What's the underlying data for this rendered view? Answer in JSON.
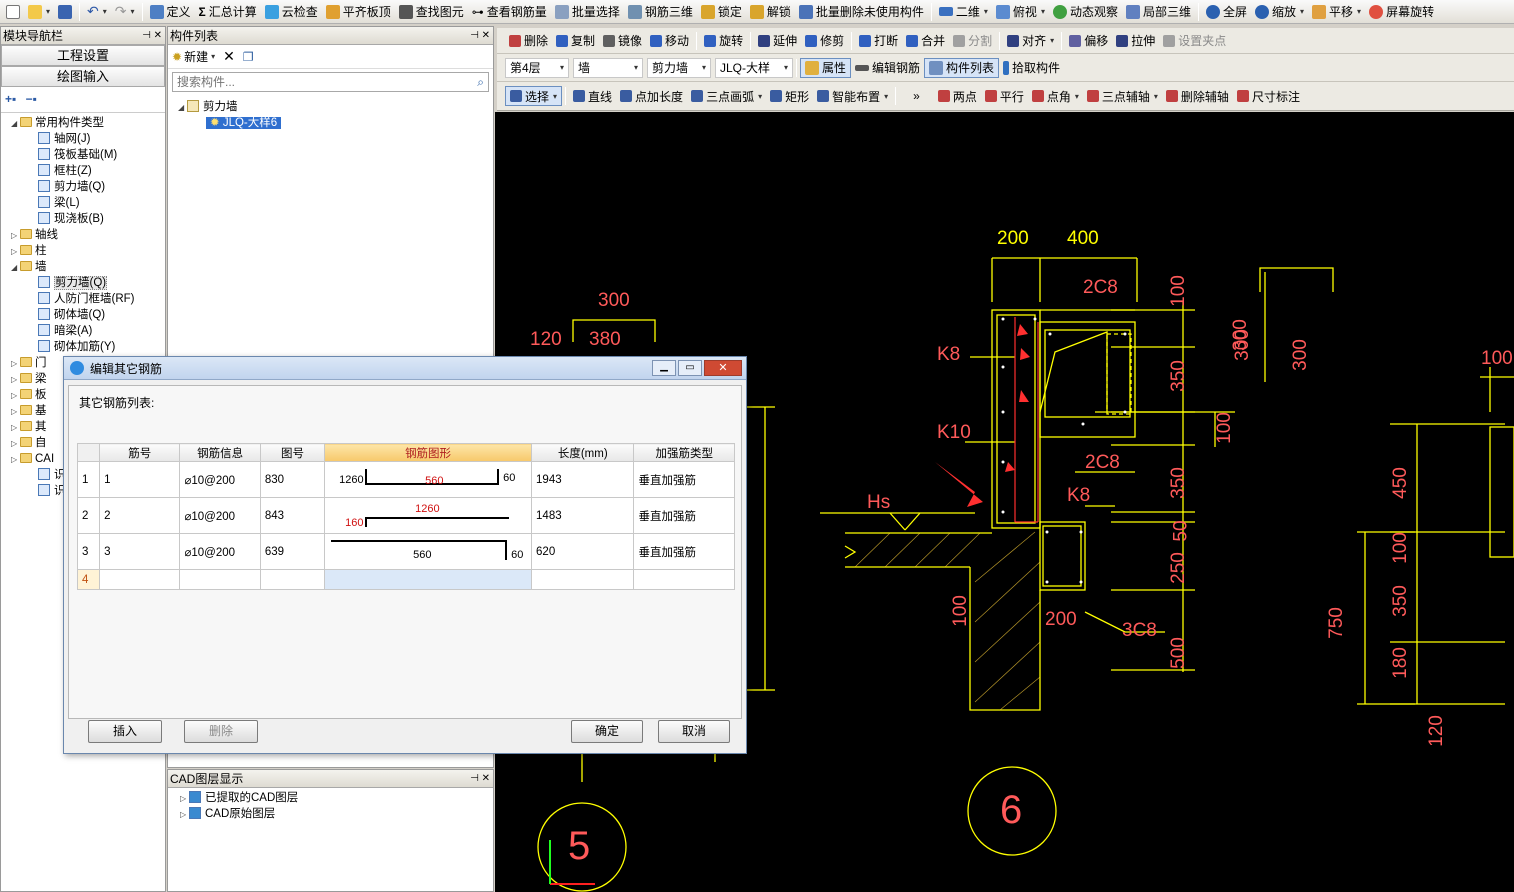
{
  "toolbar1": [
    "定义",
    "汇总计算",
    "云检查",
    "平齐板顶",
    "查找图元",
    "查看钢筋量",
    "批量选择",
    "钢筋三维",
    "锁定",
    "解锁",
    "批量删除未使用构件",
    "二维",
    "俯视",
    "动态观察",
    "局部三维",
    "全屏",
    "缩放",
    "平移",
    "屏幕旋转"
  ],
  "toolbar2": [
    "删除",
    "复制",
    "镜像",
    "移动",
    "旋转",
    "延伸",
    "修剪",
    "打断",
    "合并",
    "分割",
    "对齐",
    "偏移",
    "拉伸",
    "设置夹点"
  ],
  "toolbar3": {
    "floor": "第4层",
    "cat": "墙",
    "type": "剪力墙",
    "item": "JLQ-大样",
    "buttons": [
      "属性",
      "编辑钢筋",
      "构件列表",
      "拾取构件"
    ]
  },
  "toolbar4": [
    "选择",
    "直线",
    "点加长度",
    "三点画弧",
    "矩形",
    "智能布置",
    "两点",
    "平行",
    "点角",
    "三点辅轴",
    "删除辅轴",
    "尺寸标注"
  ],
  "nav": {
    "title": "模块导航栏",
    "btn1": "工程设置",
    "btn2": "绘图输入"
  },
  "nav_tree": [
    {
      "label": "常用构件类型",
      "level": 0,
      "open": true
    },
    {
      "label": "轴网(J)",
      "level": 1
    },
    {
      "label": "筏板基础(M)",
      "level": 1
    },
    {
      "label": "框柱(Z)",
      "level": 1
    },
    {
      "label": "剪力墙(Q)",
      "level": 1
    },
    {
      "label": "梁(L)",
      "level": 1
    },
    {
      "label": "现浇板(B)",
      "level": 1
    },
    {
      "label": "轴线",
      "level": 0
    },
    {
      "label": "柱",
      "level": 0
    },
    {
      "label": "墙",
      "level": 0,
      "open": true
    },
    {
      "label": "剪力墙(Q)",
      "level": 1
    },
    {
      "label": "人防门框墙(RF)",
      "level": 1
    },
    {
      "label": "砌体墙(Q)",
      "level": 1
    },
    {
      "label": "暗梁(A)",
      "level": 1
    },
    {
      "label": "砌体加筋(Y)",
      "level": 1
    },
    {
      "label": "门",
      "level": 0
    },
    {
      "label": "梁",
      "level": 0
    },
    {
      "label": "板",
      "level": 0
    },
    {
      "label": "基",
      "level": 0
    },
    {
      "label": "其",
      "level": 0
    },
    {
      "label": "自",
      "level": 0
    },
    {
      "label": "CAI",
      "level": 0
    },
    {
      "label": "识别桩承台",
      "level": 1
    },
    {
      "label": "识别桩",
      "level": 1
    }
  ],
  "complist": {
    "title": "构件列表",
    "new": "新建",
    "search": "搜索构件...",
    "root": "剪力墙",
    "item": "JLQ-大样6"
  },
  "cadlayers": {
    "title": "CAD图层显示",
    "items": [
      "已提取的CAD图层",
      "CAD原始图层"
    ]
  },
  "dialog": {
    "title": "编辑其它钢筋",
    "subtitle": "其它钢筋列表:",
    "headers": [
      "筋号",
      "钢筋信息",
      "图号",
      "钢筋图形",
      "长度(mm)",
      "加强筋类型"
    ],
    "rows": [
      {
        "idx": "1",
        "no": "1",
        "info": "⌀10@200",
        "fig": "830",
        "shape": {
          "l": "1260",
          "m": "560",
          "r": "60"
        },
        "len": "1943",
        "type": "垂直加强筋"
      },
      {
        "idx": "2",
        "no": "2",
        "info": "⌀10@200",
        "fig": "843",
        "shape": {
          "l": "160",
          "m": "1260",
          "r": ""
        },
        "len": "1483",
        "type": "垂直加强筋"
      },
      {
        "idx": "3",
        "no": "3",
        "info": "⌀10@200",
        "fig": "639",
        "shape": {
          "l": "",
          "m": "560",
          "r": "60"
        },
        "len": "620",
        "type": "垂直加强筋"
      }
    ],
    "newrow": "4",
    "btn_insert": "插入",
    "btn_delete": "删除",
    "btn_ok": "确定",
    "btn_cancel": "取消"
  },
  "cad": {
    "dims_top": [
      "200",
      "400"
    ],
    "labels": [
      "300",
      "120",
      "380",
      "300",
      "300",
      "2C8",
      "K8",
      "K10",
      "2C8",
      "K8",
      "Hs",
      "200",
      "3C8",
      "100",
      "100",
      "350",
      "100",
      "350",
      "50",
      "250",
      "500",
      "300",
      "300",
      "100",
      "450",
      "100",
      "350",
      "180",
      "750",
      "120"
    ],
    "circle6": "6",
    "circle5": "5"
  },
  "colors": {
    "yellow": "#ffff00",
    "red": "#ff4040",
    "bg": "#000000"
  }
}
